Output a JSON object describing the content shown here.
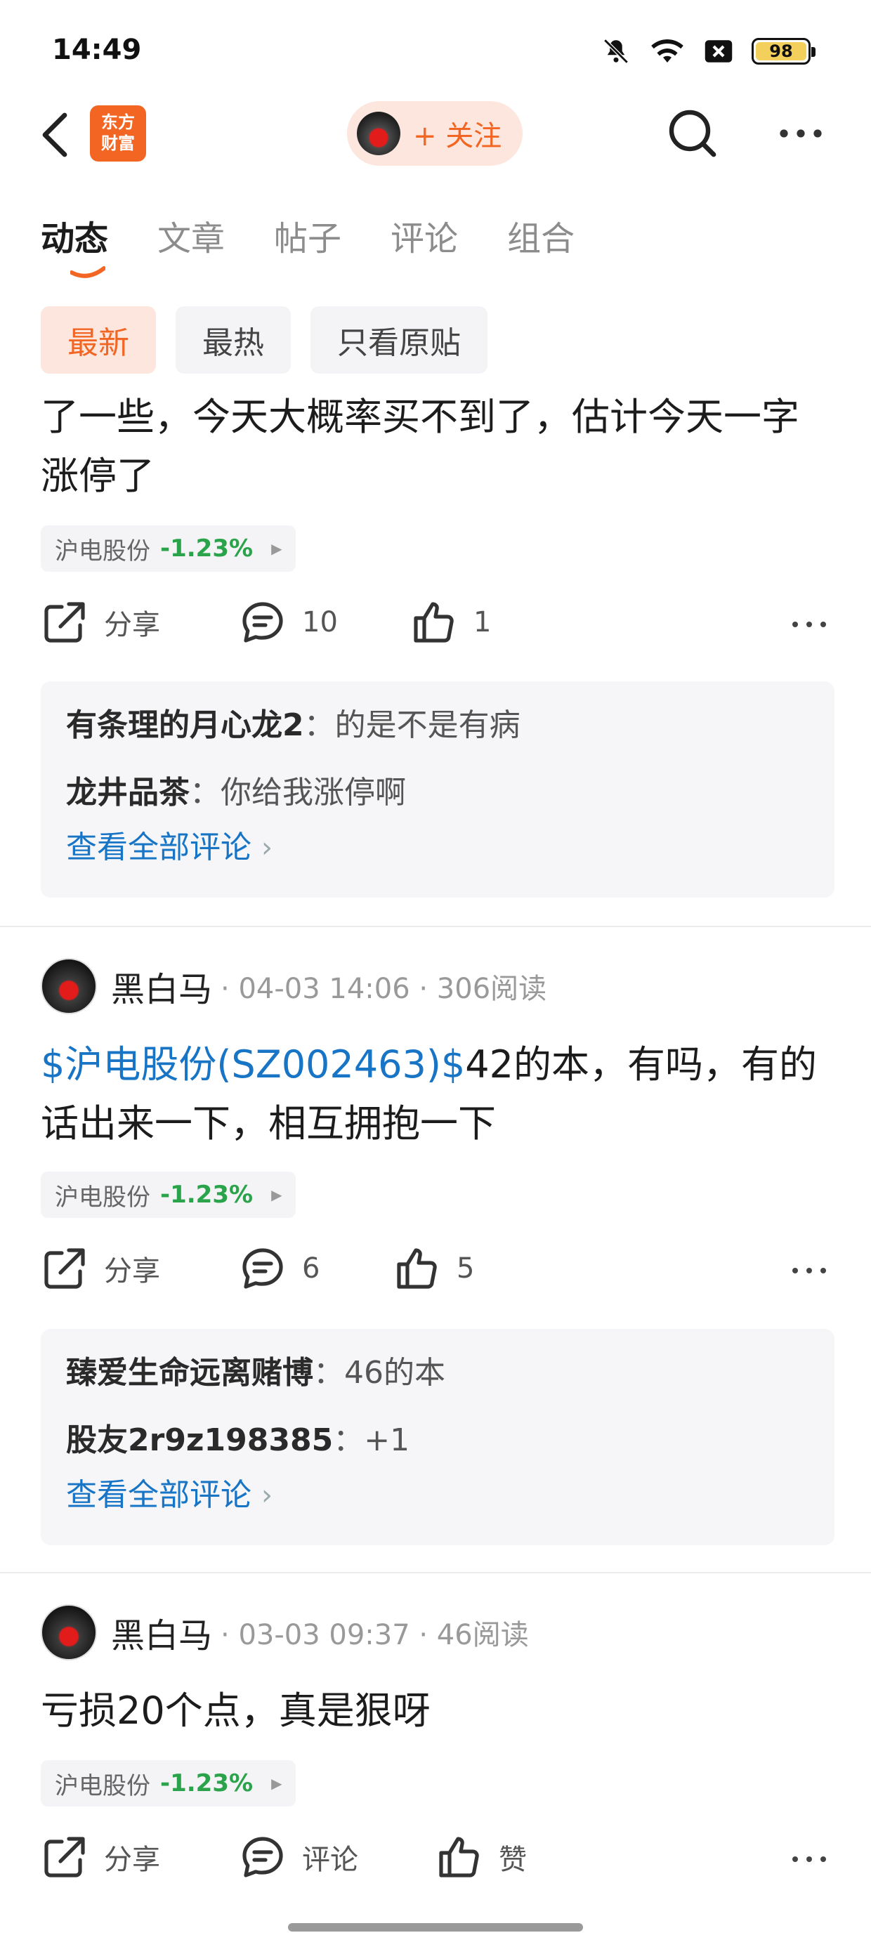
{
  "status_bar": {
    "time": "14:49",
    "battery": "98",
    "icons": [
      "bell-muted-icon",
      "wifi-icon",
      "sim-off-icon",
      "battery-icon"
    ]
  },
  "header": {
    "logo_line1": "东方",
    "logo_line2": "财富",
    "follow_label": "+ 关注",
    "brand_color": "#f26522"
  },
  "tabs": [
    {
      "label": "动态",
      "active": true
    },
    {
      "label": "文章"
    },
    {
      "label": "帖子"
    },
    {
      "label": "评论"
    },
    {
      "label": "组合"
    }
  ],
  "filters": [
    {
      "label": "最新",
      "active": true
    },
    {
      "label": "最热"
    },
    {
      "label": "只看原贴"
    }
  ],
  "posts": [
    {
      "text": "了一些，今天大概率买不到了，估计今天一字涨停了",
      "stock": {
        "name": "沪电股份",
        "change": "-1.23%"
      },
      "share_label": "分享",
      "comment_count": "10",
      "like_count": "1",
      "comments": [
        {
          "user": "有条理的月心龙2",
          "sep": "：",
          "text": "的是不是有病"
        },
        {
          "user": "龙井品茶",
          "sep": "：",
          "text": "你给我涨停啊"
        }
      ],
      "view_all": "查看全部评论"
    },
    {
      "author": "黑白马",
      "meta": "· 04-03 14:06 · 306阅读",
      "link": "$沪电股份(SZ002463)$",
      "text": "42的本，有吗，有的话出来一下，相互拥抱一下",
      "stock": {
        "name": "沪电股份",
        "change": "-1.23%"
      },
      "share_label": "分享",
      "comment_count": "6",
      "like_count": "5",
      "comments": [
        {
          "user": "臻爱生命远离赌博",
          "sep": "：",
          "text": "46的本"
        },
        {
          "user": "股友2r9z198385",
          "sep": "：",
          "text": "+1"
        }
      ],
      "view_all": "查看全部评论"
    },
    {
      "author": "黑白马",
      "meta": "· 03-03 09:37 · 46阅读",
      "text": "亏损20个点，真是狠呀",
      "stock": {
        "name": "沪电股份",
        "change": "-1.23%"
      },
      "share_label": "分享",
      "comment_label": "评论",
      "like_label": "赞"
    }
  ]
}
